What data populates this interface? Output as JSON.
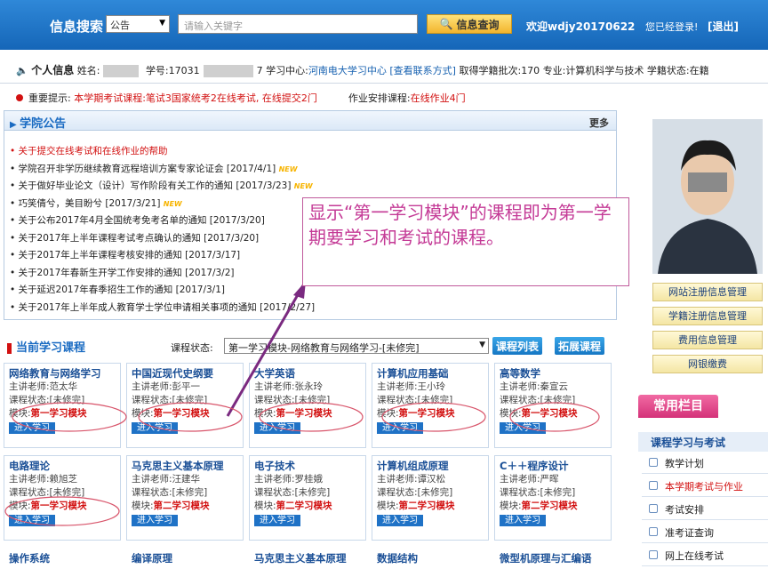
{
  "topbar": {
    "search_label": "信息搜索",
    "search_scope": "公告",
    "search_placeholder": "请输入关键字",
    "search_button": "信息查询",
    "welcome": "欢迎wdjy20170622",
    "login_status": "您已经登录!",
    "logout": "[退出]"
  },
  "personal": {
    "title": "个人信息",
    "name_label": "姓名:",
    "student_no_label": "学号:",
    "student_no_prefix": "17031",
    "student_no_suffix": "7",
    "center_label": "学习中心:",
    "center_value": "河南电大学习中心 [查看联系方式]",
    "batch_label": "取得学籍批次:",
    "batch_value": "170",
    "major_label": "专业:",
    "major_value": "计算机科学与技术",
    "status_label": "学籍状态:",
    "status_value": "在籍"
  },
  "notice": {
    "label": "重要提示:",
    "exam_label": "本学期考试课程:",
    "exam_value": "笔试3国家统考2在线考试, 在线提交2门",
    "homework_label": "作业安排课程:",
    "homework_value": "在线作业4门"
  },
  "announcements": {
    "title": "学院公告",
    "more": "更多",
    "items": [
      {
        "text": "关于提交在线考试和在线作业的帮助",
        "date": "",
        "new": ""
      },
      {
        "text": "学院召开非学历继续教育远程培训方案专家论证会",
        "date": "[2017/4/1]",
        "new": "NEW"
      },
      {
        "text": "关于做好毕业论文（设计）写作阶段有关工作的通知",
        "date": "[2017/3/23]",
        "new": "NEW"
      },
      {
        "text": "巧笑倩兮，美目盼兮",
        "date": "[2017/3/21]",
        "new": "NEW"
      },
      {
        "text": "关于公布2017年4月全国统考免考名单的通知",
        "date": "[2017/3/20]",
        "new": ""
      },
      {
        "text": "关于2017年上半年课程考试考点确认的通知",
        "date": "[2017/3/20]",
        "new": ""
      },
      {
        "text": "关于2017年上半年课程考核安排的通知",
        "date": "[2017/3/17]",
        "new": ""
      },
      {
        "text": "关于2017年春新生开学工作安排的通知",
        "date": "[2017/3/2]",
        "new": ""
      },
      {
        "text": "关于延迟2017年春季招生工作的通知",
        "date": "[2017/3/1]",
        "new": ""
      },
      {
        "text": "关于2017年上半年成人教育学士学位申请相关事项的通知",
        "date": "[2017/2/27]",
        "new": ""
      }
    ]
  },
  "courses": {
    "title": "当前学习课程",
    "status_label": "课程状态:",
    "status_select": "第一学习模块-网络教育与网络学习-[未修完]",
    "list_button": "课程列表",
    "expand_button": "拓展课程",
    "teacher_label": "主讲老师:",
    "state_label": "课程状态:",
    "module_label": "模块:",
    "go_label": "进入学习",
    "items": [
      {
        "name": "网络教育与网络学习",
        "teacher": "范太华",
        "state": "[未修完]",
        "module": "第一学习模块"
      },
      {
        "name": "中国近现代史纲要",
        "teacher": "彭平一",
        "state": "[未修完]",
        "module": "第一学习模块"
      },
      {
        "name": "大学英语",
        "teacher": "张永玲",
        "state": "[未修完]",
        "module": "第一学习模块"
      },
      {
        "name": "计算机应用基础",
        "teacher": "王小玲",
        "state": "[未修完]",
        "module": "第一学习模块"
      },
      {
        "name": "高等数学",
        "teacher": "秦宣云",
        "state": "[未修完]",
        "module": "第一学习模块"
      },
      {
        "name": "电路理论",
        "teacher": "赖旭芝",
        "state": "[未修完]",
        "module": "第一学习模块"
      },
      {
        "name": "马克思主义基本原理",
        "teacher": "汪建华",
        "state": "[未修完]",
        "module": "第二学习模块"
      },
      {
        "name": "电子技术",
        "teacher": "罗桂娥",
        "state": "[未修完]",
        "module": "第二学习模块"
      },
      {
        "name": "计算机组成原理",
        "teacher": "谭汉松",
        "state": "[未修完]",
        "module": "第二学习模块"
      },
      {
        "name": "C＋＋程序设计",
        "teacher": "严晖",
        "state": "[未修完]",
        "module": "第二学习模块"
      }
    ],
    "next_row": [
      "操作系统",
      "编译原理",
      "马克思主义基本原理",
      "数据结构",
      "微型机原理与汇编语"
    ]
  },
  "right": {
    "buttons": [
      "网站注册信息管理",
      "学籍注册信息管理",
      "费用信息管理",
      "网银缴费"
    ],
    "tab": "常用栏目",
    "section": "课程学习与考试",
    "items": [
      {
        "label": "教学计划",
        "active": false
      },
      {
        "label": "本学期考试与作业",
        "active": true
      },
      {
        "label": "考试安排",
        "active": false
      },
      {
        "label": "准考证查询",
        "active": false
      },
      {
        "label": "网上在线考试",
        "active": false
      }
    ]
  },
  "callout": {
    "text": "显示“第一学习模块”的课程即为第一学期要学习和考试的课程。"
  },
  "colors": {
    "header": "#1a6fc4",
    "accent_red": "#d21010",
    "callout": "#c43a96"
  }
}
